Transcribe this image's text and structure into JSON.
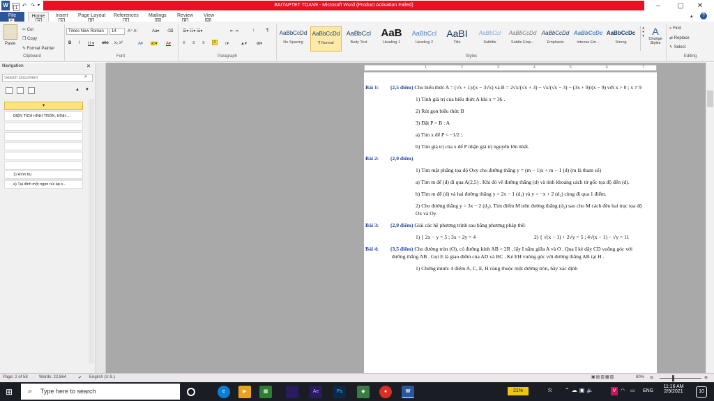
{
  "window": {
    "title": "BAITAPTET TOAN9 - Microsoft Word (Product Activation Failed)"
  },
  "quick_access": {
    "keytip": "1"
  },
  "tabs": [
    {
      "label": "File",
      "key": "F"
    },
    {
      "label": "Home",
      "key": "H"
    },
    {
      "label": "Insert",
      "key": "N"
    },
    {
      "label": "Page Layout",
      "key": "P"
    },
    {
      "label": "References",
      "key": "S"
    },
    {
      "label": "Mailings",
      "key": "M"
    },
    {
      "label": "Review",
      "key": "R"
    },
    {
      "label": "View",
      "key": "W"
    }
  ],
  "clipboard": {
    "paste": "Paste",
    "cut": "Cut",
    "copy": "Copy",
    "format_painter": "Format Painter",
    "group": "Clipboard"
  },
  "font": {
    "name": "Times New Roman",
    "size": "14",
    "group": "Font"
  },
  "paragraph": {
    "group": "Paragraph"
  },
  "styles": {
    "group": "Styles",
    "items": [
      {
        "preview": "AaBbCcDd",
        "name": "No Spacing"
      },
      {
        "preview": "AaBbCcDd",
        "name": "¶ Normal"
      },
      {
        "preview": "AaBbCcI",
        "name": "Body Text"
      },
      {
        "preview": "AaB",
        "name": "Heading 1"
      },
      {
        "preview": "AaBbCcI",
        "name": "Heading 2"
      },
      {
        "preview": "AaBI",
        "name": "Title"
      },
      {
        "preview": "AaBbCcI",
        "name": "Subtitle"
      },
      {
        "preview": "AaBbCcDd",
        "name": "Subtle Emp..."
      },
      {
        "preview": "AaBbCcDd",
        "name": "Emphasis"
      },
      {
        "preview": "AaBbCcDc",
        "name": "Intense Em..."
      },
      {
        "preview": "AaBbCcDc",
        "name": "Strong"
      }
    ],
    "change_styles": "Change Styles"
  },
  "editing": {
    "find": "Find",
    "replace": "Replace",
    "select": "Select",
    "group": "Editing"
  },
  "navigation": {
    "title": "Navigation",
    "search_placeholder": "Search Document",
    "items": [
      "DIỆN TÍCH HÌNH TRÒN, HÌNH ...",
      "1) Hình trụ",
      "a) Tại đỉnh một ngọn núi áp s..."
    ]
  },
  "document": {
    "b1_label": "Bài 1:",
    "b1_pts": "(2,5 điểm)",
    "b1_intro": "Cho biểu thức A = (√x + 1)/(x − 3√x) và B = 2√x/(√x + 3) − √x/(√x − 3) − (3x + 9)/(x − 9) với x > 0 ; x ≠ 9",
    "b1_1": "1) Tính giá trị của biểu thức A khi x = 36 .",
    "b1_2": "2) Rút gọn biểu thức B",
    "b1_3": "3) Đặt P = B : A",
    "b1_3a": "a) Tìm x để P < −1/2 ;",
    "b1_3b": "b) Tìm giá trị của x để P nhận giá trị nguyên lớn nhất.",
    "b2_label": "Bài 2:",
    "b2_pts": "(2,0 điểm)",
    "b2_1": "1) Tìm mặt phẳng tọa độ Oxy cho đường thẳng y = (m − 1)x + m − 1 (d) (m là tham số)",
    "b2_1a": "a) Tìm m để (d) đi qua A(2,5) . Khi đó vẽ đường thẳng (d) và tính khoảng cách từ gốc tọa độ đến (d).",
    "b2_1b": "b) Tìm m để (d) và hai đường thẳng y = 2x − 1 (d₁) và y = −x + 2 (d₂) cùng đi qua 1 điểm.",
    "b2_2": "2) Cho đường thẳng y = 3x − 2 (d₃). Tìm điểm M trên đường thẳng (d₃) sao cho M cách đều hai trục tọa độ Ox và Oy.",
    "b3_label": "Bài 3:",
    "b3_pts": "(2,0 điểm)",
    "b3_intro": "Giải các hệ phương trình sau bằng phương pháp thế:",
    "b3_1": "1) { 2x − y = 5 ; 3x + 2y = 4",
    "b3_2": "2) { √(x − 1) + 2√y = 5 ; 4√(x − 1) − √y = 11",
    "b4_label": "Bài 4:",
    "b4_pts": "(3,5 điểm)",
    "b4_intro": "Cho đường tròn (O), có đường kính AB = 2R , lấy I nằm giữa A và O . Qua I kẻ dây CD vuông góc với đường thẳng AB . Gọi E là giao điểm của AD và BC . Kẻ EH vuông góc với đường thẳng AB tại H .",
    "b4_1": "1) Chứng minh: 4 điểm A, C, E, H cùng thuộc một đường tròn, hãy xác định"
  },
  "ruler": {
    "ticks": [
      "1",
      "2",
      "3",
      "4",
      "5",
      "6",
      "7"
    ]
  },
  "status": {
    "page": "Page: 2 of 58",
    "words": "Words: 22,864",
    "language": "English (U.S.)",
    "zoom": "80%"
  },
  "taskbar": {
    "search": "Type here to search",
    "battery": "21%",
    "lang": "ENG",
    "time": "11:16 AM",
    "date": "2/9/2021",
    "notif": "10",
    "icons": [
      {
        "name": "task-view-icon",
        "label": "○",
        "color": "#1a1d23"
      },
      {
        "name": "edge-icon",
        "label": "e",
        "color": "#0b7fd4"
      },
      {
        "name": "media-icon",
        "label": "▶",
        "color": "#e8a317"
      },
      {
        "name": "files-icon",
        "label": "▦",
        "color": "#2d7d32"
      },
      {
        "name": "premiere-icon",
        "label": "",
        "color": "#2a1a5e"
      },
      {
        "name": "after-effects-icon",
        "label": "Ae",
        "color": "#2a1a5e"
      },
      {
        "name": "photoshop-icon",
        "label": "Ps",
        "color": "#0b2a4a"
      },
      {
        "name": "app-icon",
        "label": "◆",
        "color": "#3a7d44"
      },
      {
        "name": "chrome-icon",
        "label": "●",
        "color": "#d93025"
      },
      {
        "name": "word-icon",
        "label": "W",
        "color": "#2b579a"
      }
    ]
  },
  "colors": {
    "accent": "#2b579a",
    "title_red": "#e81123",
    "nav_highlight": "#fbe57d"
  }
}
